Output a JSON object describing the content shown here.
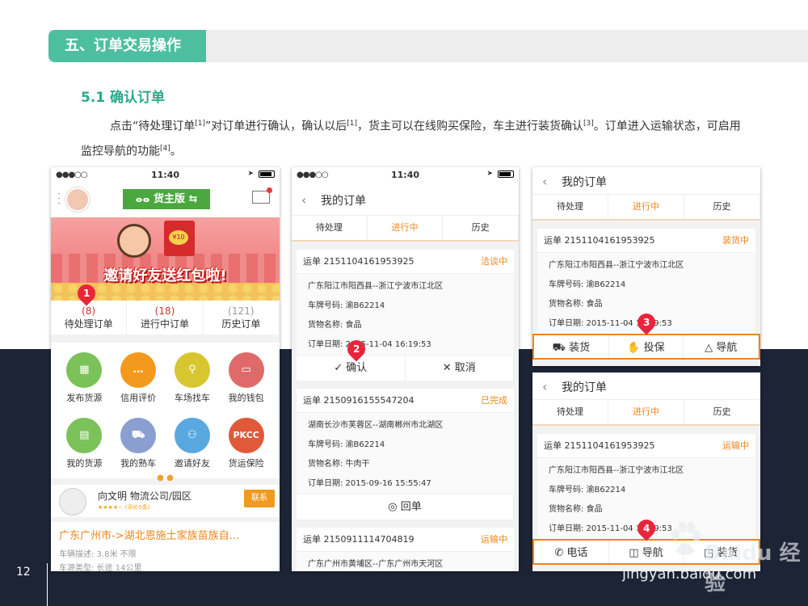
{
  "section": {
    "title": "五、订单交易操作"
  },
  "subsection": {
    "title": "5.1 确认订单"
  },
  "intro": {
    "p1": "点击“待处理订单",
    "r1": "[1]",
    "p2": "”对订单进行确认，确认以后",
    "r2": "[1]",
    "p3": "，货主可以在线购买保险，车主进行装货确认",
    "r3": "[3]",
    "p4": "。订单进入运输状态，可启用监控导航的功能",
    "r4": "[4]",
    "p5": "。"
  },
  "page_number": "12",
  "watermark": {
    "url": "jingyan.baidu.com",
    "logo": "Baidu 经验"
  },
  "status": {
    "signal": "●●●○○",
    "time": "11:40"
  },
  "phone1": {
    "brand": "货主版",
    "brand_mark": "ⴰⴰ",
    "banner_coin": "¥10",
    "banner_text": "邀请好友送红包啦!",
    "orders": [
      {
        "count": "(8)",
        "label": "待处理订单"
      },
      {
        "count": "(18)",
        "label": "进行中订单"
      },
      {
        "count": "(121)",
        "label": "历史订单"
      }
    ],
    "grid": [
      {
        "label": "发布货源",
        "icon": "▦",
        "color": "#7cc25a"
      },
      {
        "label": "信用评价",
        "icon": "…",
        "color": "#f39a1e"
      },
      {
        "label": "车场找车",
        "icon": "⚲",
        "color": "#d8c630"
      },
      {
        "label": "我的钱包",
        "icon": "▭",
        "color": "#e06a6a"
      },
      {
        "label": "我的货源",
        "icon": "▤",
        "color": "#7cc25a"
      },
      {
        "label": "我的熟车",
        "icon": "⛟",
        "color": "#8a9fd0"
      },
      {
        "label": "邀请好友",
        "icon": "⚇",
        "color": "#5aa8e0"
      },
      {
        "label": "货运保险",
        "icon": "PKCC",
        "color": "#e05a3a"
      }
    ],
    "page_dots": "● ●",
    "profile": {
      "name": "向文明  物流公司/园区",
      "sub": "★★★★☆ (评价0条)",
      "contact": "联系"
    },
    "route": {
      "title": "广东广州市->湖北恩施土家族苗族自...",
      "desc": "车辆描述: 3.8米  不限",
      "type": "车源类型: 长途  14公里"
    }
  },
  "phone2": {
    "nav_title": "我的订单",
    "tabs": [
      "待处理",
      "进行中",
      "历史"
    ],
    "orders": [
      {
        "no": "运单  2151104161953925",
        "status": "洽谈中",
        "route": "广东阳江市阳西县--浙江宁波市江北区",
        "plate": "车牌号码:  渝B62214",
        "goods": "货物名称:  食品",
        "date": "订单日期:  2015-11-04 16:19:53",
        "actions": [
          "✓ 确认",
          "✕ 取消"
        ]
      },
      {
        "no": "运单  2150916155547204",
        "status": "已完成",
        "route": "湖南长沙市芙蓉区--湖南郴州市北湖区",
        "plate": "车牌号码:  渝B62214",
        "goods": "货物名称:  牛肉干",
        "date": "订单日期:  2015-09-16 15:55:47",
        "actions": [
          "◎ 回单"
        ]
      },
      {
        "no": "运单  2150911114704819",
        "status": "运输中",
        "route": "广东广州市黄埔区--广东广州市天河区"
      }
    ]
  },
  "phone3": {
    "nav_title": "我的订单",
    "tabs": [
      "待处理",
      "进行中",
      "历史"
    ],
    "order": {
      "no": "运单  2151104161953925",
      "status": "装货中",
      "route": "广东阳江市阳西县--浙江宁波市江北区",
      "plate": "车牌号码:  渝B62214",
      "goods": "货物名称:  食品",
      "date": "订单日期:  2015-11-04 16:19:53"
    },
    "actions": [
      "⛟ 装货",
      "✋ 投保",
      "△ 导航"
    ]
  },
  "phone4": {
    "nav_title": "我的订单",
    "tabs": [
      "待处理",
      "进行中",
      "历史"
    ],
    "order": {
      "no": "运单  2151104161953925",
      "status": "运输中",
      "route": "广东阳江市阳西县--浙江宁波市江北区",
      "plate": "车牌号码:  渝B62214",
      "goods": "货物名称:  食品",
      "date": "订单日期:  2015-11-04 16:19:53"
    },
    "actions": [
      "✆ 电话",
      "◫ 导航",
      "◳ 装货"
    ]
  },
  "badges": [
    "1",
    "2",
    "3",
    "4"
  ],
  "colors": {
    "teal": "#4dbfa0",
    "orange": "#f08419",
    "badge_red": "#e8253b",
    "dark": "#1d2436"
  }
}
